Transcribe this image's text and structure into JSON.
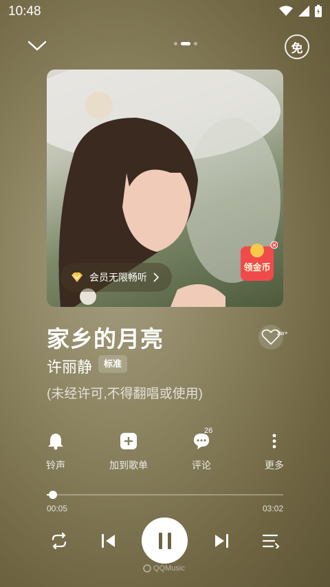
{
  "status_bar": {
    "time": "10:48"
  },
  "header": {
    "free_label": "免"
  },
  "album": {
    "vip_label": "会员无限畅听",
    "promo_label": "领金币"
  },
  "song": {
    "title": "家乡的月亮",
    "artist": "许丽静",
    "quality": "标准",
    "notice": "(未经许可,不得翻唱或使用)",
    "like_count": "1w+"
  },
  "actions": [
    {
      "label": "铃声",
      "icon": "bell-icon"
    },
    {
      "label": "加到歌单",
      "icon": "add-to-playlist-icon"
    },
    {
      "label": "评论",
      "icon": "comment-icon",
      "badge": "26"
    },
    {
      "label": "更多",
      "icon": "more-icon"
    }
  ],
  "progress": {
    "current": "00:05",
    "total": "03:02",
    "fraction": 0.027
  },
  "brand": "QQMusic",
  "colors": {
    "accent": "#ffffff",
    "background": "#8d8462"
  }
}
